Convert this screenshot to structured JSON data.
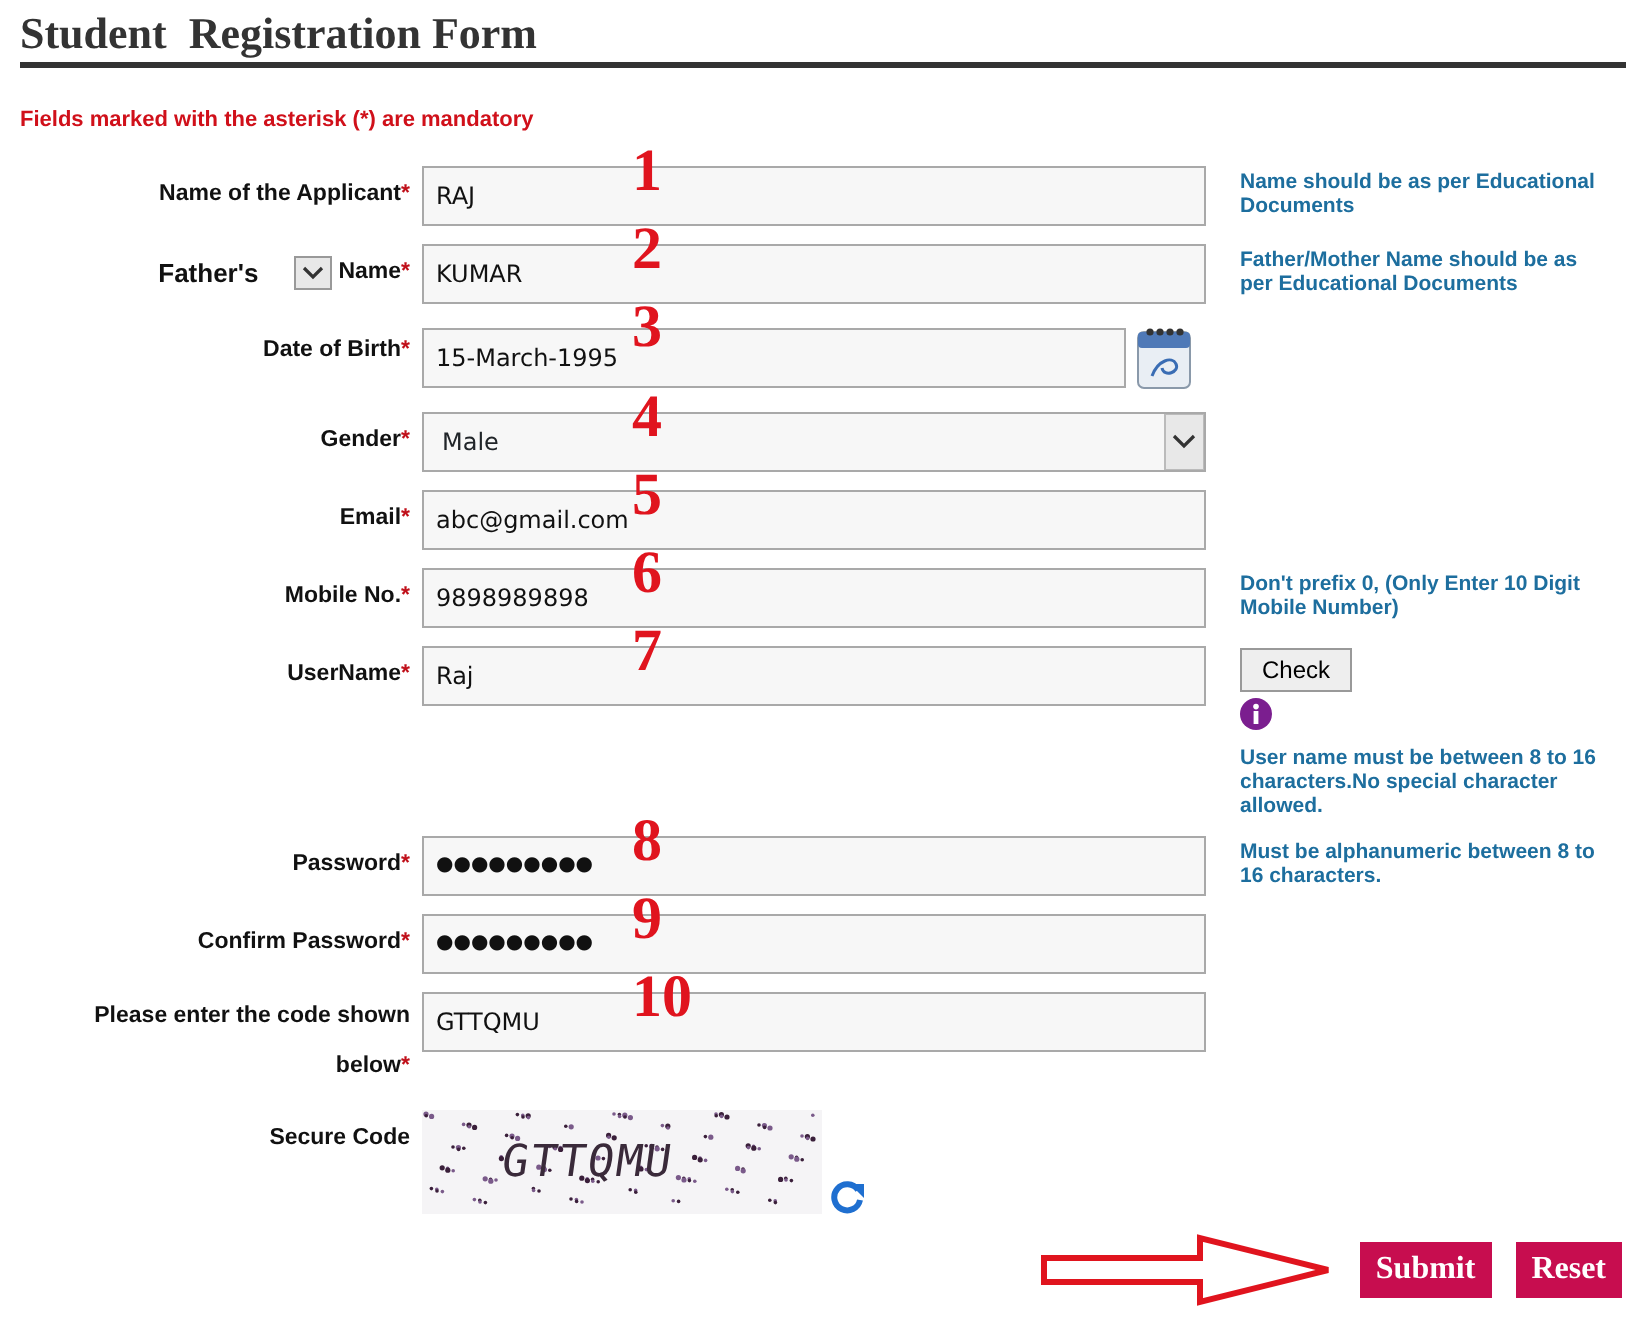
{
  "title": "Student  Registration Form",
  "mandatory_note": "Fields marked with the asterisk (*) are mandatory",
  "fields": [
    {
      "kind": "text",
      "label": "Name of the Applicant",
      "asterisk": "*",
      "value": "RAJ",
      "annotation": "1",
      "hint": "Name should be as per Educational Documents"
    },
    {
      "kind": "relation",
      "prefix": "Father's",
      "label": "Name",
      "asterisk": "*",
      "value": "KUMAR",
      "annotation": "2",
      "hint": "Father/Mother Name should be as per Educational Documents"
    },
    {
      "kind": "date",
      "label": "Date of Birth",
      "asterisk": "*",
      "value": "15-March-1995",
      "annotation": "3"
    },
    {
      "kind": "select",
      "label": "Gender",
      "asterisk": "*",
      "value": "Male",
      "annotation": "4"
    },
    {
      "kind": "text",
      "label": "Email",
      "asterisk": "*",
      "value": "abc@gmail.com",
      "annotation": "5"
    },
    {
      "kind": "text",
      "label": "Mobile No.",
      "asterisk": "*",
      "value": "9898989898",
      "annotation": "6",
      "hint": "Don't prefix 0, (Only Enter 10 Digit Mobile Number)"
    },
    {
      "kind": "username",
      "label": "UserName",
      "asterisk": "*",
      "value": "Raj",
      "annotation": "7",
      "button": "Check",
      "hint": "User name must be between 8 to 16 characters.No special character allowed."
    },
    {
      "kind": "password",
      "label": "Password",
      "asterisk": "*",
      "value": "●●●●●●●●●",
      "annotation": "8",
      "hint": "Must be alphanumeric between 8 to 16 characters."
    },
    {
      "kind": "password",
      "label": "Confirm Password",
      "asterisk": "*",
      "value": "●●●●●●●●●",
      "annotation": "9"
    },
    {
      "kind": "text",
      "label": "Please enter the code shown below",
      "asterisk": "*",
      "value": "GTTQMU",
      "annotation": "10"
    },
    {
      "kind": "captcha",
      "label": "Secure Code",
      "captcha_text": "GTTQMU"
    }
  ],
  "buttons": [
    "Submit",
    "Reset"
  ]
}
